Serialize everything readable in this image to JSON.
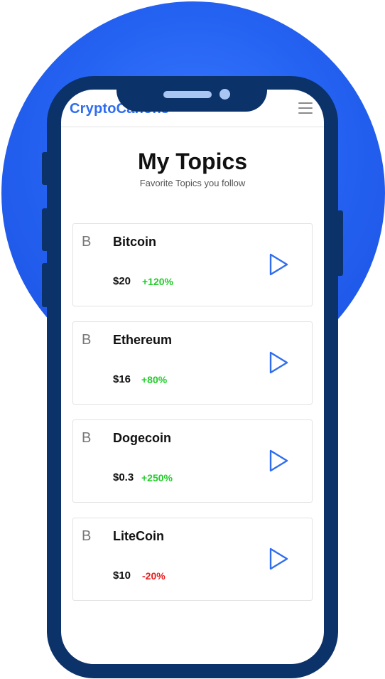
{
  "app": {
    "brand": "CryptoCanons"
  },
  "page": {
    "title": "My Topics",
    "subtitle": "Favorite Topics you follow"
  },
  "topics": [
    {
      "letter": "B",
      "name": "Bitcoin",
      "price": "$20",
      "change": "+120%",
      "trend": "up"
    },
    {
      "letter": "B",
      "name": "Ethereum",
      "price": "$16",
      "change": "+80%",
      "trend": "up"
    },
    {
      "letter": "B",
      "name": "Dogecoin",
      "price": "$0.3",
      "change": "+250%",
      "trend": "up"
    },
    {
      "letter": "B",
      "name": "LiteCoin",
      "price": "$10",
      "change": "-20%",
      "trend": "down"
    }
  ],
  "icons": {
    "menu": "hamburger-menu-icon",
    "play": "play-icon"
  },
  "colors": {
    "brand": "#2f6df0",
    "phone_frame": "#0b3269",
    "background_circle": "#2563f2",
    "positive": "#22cc2a",
    "negative": "#e82020",
    "play_icon": "#2f6df0"
  }
}
